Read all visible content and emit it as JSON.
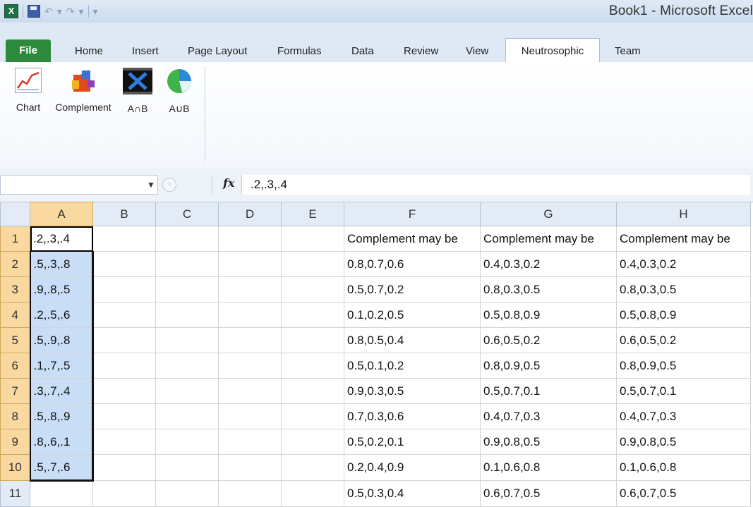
{
  "window": {
    "title": "Book1  -  Microsoft Excel",
    "qat_undo": "↶",
    "qat_redo": "↷",
    "qat_customize": "▾"
  },
  "tabs": [
    "File",
    "Home",
    "Insert",
    "Page Layout",
    "Formulas",
    "Data",
    "Review",
    "View",
    "Neutrosophic",
    "Team"
  ],
  "ribbon": {
    "buttons": [
      {
        "label": "Chart",
        "icon": "chart-icon"
      },
      {
        "label": "Complement",
        "icon": "puzzle-icon"
      },
      {
        "label": "A∩B",
        "icon": "intersection-icon"
      },
      {
        "label": "A∪B",
        "icon": "union-icon"
      }
    ]
  },
  "formula_bar": {
    "name_box": "",
    "fx": "fx",
    "value": ".2,.3,.4"
  },
  "sheet": {
    "columns": [
      "A",
      "B",
      "C",
      "D",
      "E",
      "F",
      "G",
      "H"
    ],
    "rows": [
      {
        "n": "1",
        "A": ".2,.3,.4",
        "F": "Complement may be",
        "G": "Complement may be",
        "H": "Complement may be"
      },
      {
        "n": "2",
        "A": ".5,.3,.8",
        "F": "0.8,0.7,0.6",
        "G": "0.4,0.3,0.2",
        "H": "0.4,0.3,0.2"
      },
      {
        "n": "3",
        "A": ".9,.8,.5",
        "F": "0.5,0.7,0.2",
        "G": "0.8,0.3,0.5",
        "H": "0.8,0.3,0.5"
      },
      {
        "n": "4",
        "A": ".2,.5,.6",
        "F": "0.1,0.2,0.5",
        "G": "0.5,0.8,0.9",
        "H": "0.5,0.8,0.9"
      },
      {
        "n": "5",
        "A": ".5,.9,.8",
        "F": "0.8,0.5,0.4",
        "G": "0.6,0.5,0.2",
        "H": "0.6,0.5,0.2"
      },
      {
        "n": "6",
        "A": ".1,.7,.5",
        "F": "0.5,0.1,0.2",
        "G": "0.8,0.9,0.5",
        "H": "0.8,0.9,0.5"
      },
      {
        "n": "7",
        "A": ".3,.7,.4",
        "F": "0.9,0.3,0.5",
        "G": "0.5,0.7,0.1",
        "H": "0.5,0.7,0.1"
      },
      {
        "n": "8",
        "A": ".5,.8,.9",
        "F": "0.7,0.3,0.6",
        "G": "0.4,0.7,0.3",
        "H": "0.4,0.7,0.3"
      },
      {
        "n": "9",
        "A": ".8,.6,.1",
        "F": "0.5,0.2,0.1",
        "G": "0.9,0.8,0.5",
        "H": "0.9,0.8,0.5"
      },
      {
        "n": "10",
        "A": ".5,.7,.6",
        "F": "0.2,0.4,0.9",
        "G": "0.1,0.6,0.8",
        "H": "0.1,0.6,0.8"
      },
      {
        "n": "11",
        "A": "",
        "F": "0.5,0.3,0.4",
        "G": "0.6,0.7,0.5",
        "H": "0.6,0.7,0.5"
      }
    ]
  }
}
